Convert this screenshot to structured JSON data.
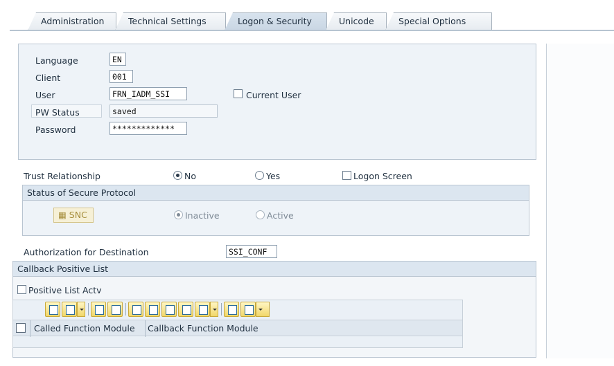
{
  "tabs": [
    {
      "label": "Administration"
    },
    {
      "label": "Technical Settings"
    },
    {
      "label": "Logon & Security"
    },
    {
      "label": "Unicode"
    },
    {
      "label": "Special Options"
    }
  ],
  "logon": {
    "language_label": "Language",
    "language_value": "EN",
    "client_label": "Client",
    "client_value": "001",
    "user_label": "User",
    "user_value": "FRN_IADM_SSI",
    "current_user_label": "Current User",
    "pw_status_label": "PW Status",
    "pw_status_value": "saved",
    "password_label": "Password",
    "password_value": "*************"
  },
  "trust": {
    "label": "Trust Relationship",
    "no_label": "No",
    "yes_label": "Yes",
    "logon_screen_label": "Logon Screen",
    "selected": "No"
  },
  "secure_protocol": {
    "header": "Status of Secure Protocol",
    "snc_label": "SNC",
    "inactive_label": "Inactive",
    "active_label": "Active",
    "selected": "Inactive"
  },
  "authorization": {
    "label": "Authorization for Destination",
    "value": "SSI_CONF"
  },
  "callback": {
    "header": "Callback Positive List",
    "positive_list_label": "Positive List Actv",
    "columns": [
      "Called Function Module",
      "Callback Function Module"
    ]
  }
}
